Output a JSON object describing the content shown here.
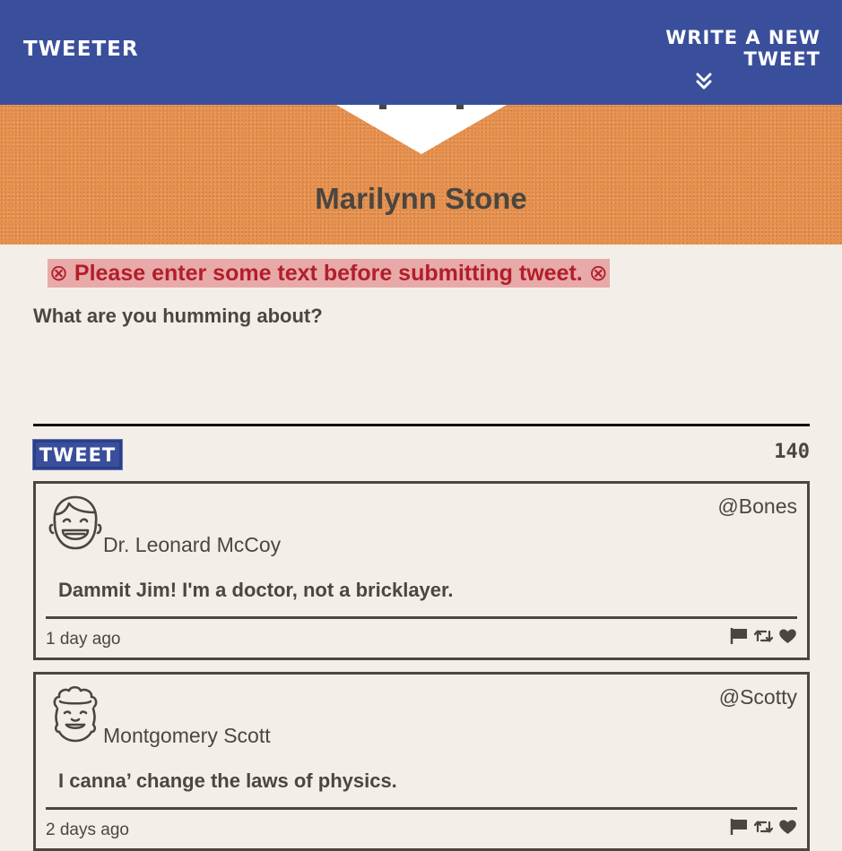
{
  "nav": {
    "brand": "Tweeter",
    "compose_label": "Write a new tweet",
    "compose_icon": "double-chevron-down-icon"
  },
  "profile": {
    "name": "Marilynn Stone",
    "banner_color": "#e8914f"
  },
  "composer": {
    "error": "Please enter some text before submitting tweet.",
    "error_icon": "⊗",
    "prompt": "What are you humming about?",
    "text": "",
    "button_label": "Tweet",
    "counter": "140"
  },
  "tweets": [
    {
      "handle": "@Bones",
      "name": "Dr. Leonard McCoy",
      "content": "Dammit Jim! I'm a doctor, not a bricklayer.",
      "time": "1 day ago",
      "avatar": "smiling-face-avatar"
    },
    {
      "handle": "@Scotty",
      "name": "Montgomery Scott",
      "content": "I canna’ change the laws of physics.",
      "time": "2 days ago",
      "avatar": "curly-hair-avatar"
    }
  ],
  "colors": {
    "nav": "#3a4f9b",
    "background": "#f3efe8",
    "text": "#4a4640",
    "error_bg": "#e8a9a9",
    "error_text": "#b21e2a"
  }
}
